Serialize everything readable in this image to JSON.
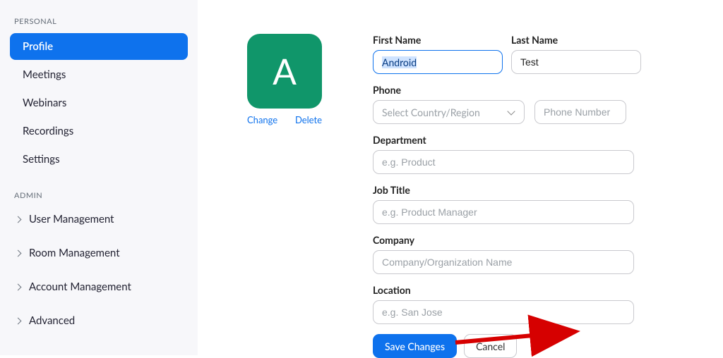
{
  "sidebar": {
    "personal_header": "PERSONAL",
    "personal_items": [
      {
        "label": "Profile",
        "active": true
      },
      {
        "label": "Meetings",
        "active": false
      },
      {
        "label": "Webinars",
        "active": false
      },
      {
        "label": "Recordings",
        "active": false
      },
      {
        "label": "Settings",
        "active": false
      }
    ],
    "admin_header": "ADMIN",
    "admin_items": [
      {
        "label": "User Management"
      },
      {
        "label": "Room Management"
      },
      {
        "label": "Account Management"
      },
      {
        "label": "Advanced"
      }
    ]
  },
  "avatar": {
    "initial": "A",
    "change_label": "Change",
    "delete_label": "Delete"
  },
  "form": {
    "first_name_label": "First Name",
    "first_name_value": "Android",
    "last_name_label": "Last Name",
    "last_name_value": "Test",
    "phone_label": "Phone",
    "country_placeholder": "Select Country/Region",
    "phone_number_placeholder": "Phone Number",
    "department_label": "Department",
    "department_placeholder": "e.g. Product",
    "job_title_label": "Job Title",
    "job_title_placeholder": "e.g. Product Manager",
    "company_label": "Company",
    "company_placeholder": "Company/Organization Name",
    "location_label": "Location",
    "location_placeholder": "e.g. San Jose"
  },
  "actions": {
    "save_label": "Save Changes",
    "cancel_label": "Cancel"
  }
}
